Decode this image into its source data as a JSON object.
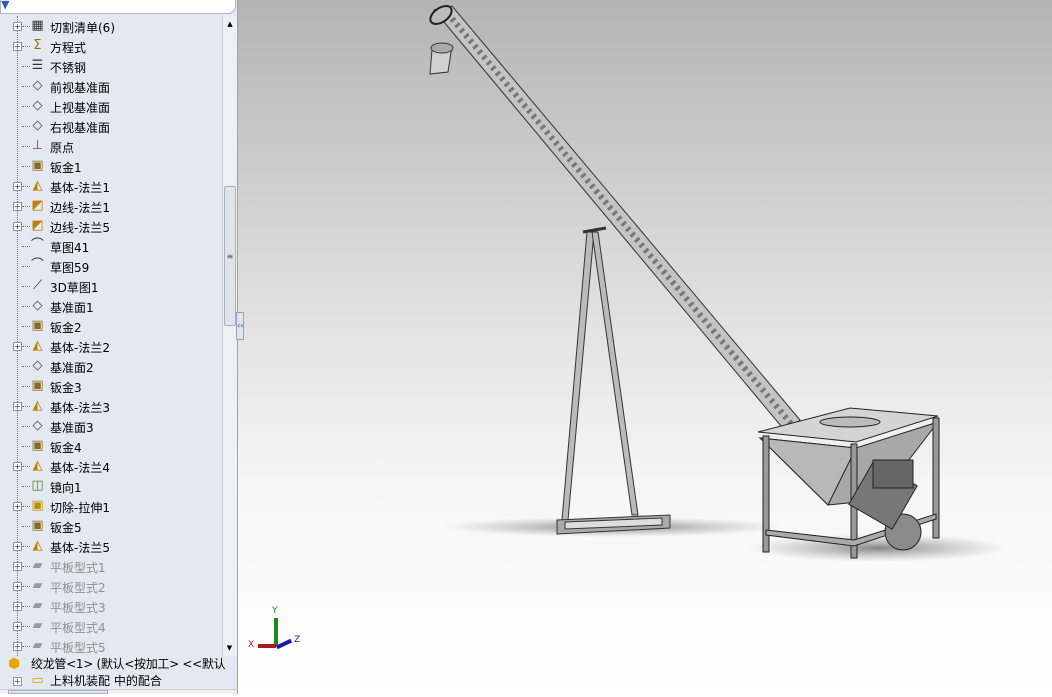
{
  "tree": {
    "items": [
      {
        "label": "切割清单(6)",
        "icon": "cut-list-icon",
        "expand": true
      },
      {
        "label": "方程式",
        "icon": "equations-folder-icon",
        "expand": true
      },
      {
        "label": "不锈钢",
        "icon": "material-icon",
        "expand": false
      },
      {
        "label": "前视基准面",
        "icon": "plane-icon",
        "expand": false
      },
      {
        "label": "上视基准面",
        "icon": "plane-icon",
        "expand": false
      },
      {
        "label": "右视基准面",
        "icon": "plane-icon",
        "expand": false
      },
      {
        "label": "原点",
        "icon": "origin-icon",
        "expand": false
      },
      {
        "label": "钣金1",
        "icon": "sheet-metal-icon",
        "expand": false
      },
      {
        "label": "基体-法兰1",
        "icon": "base-flange-icon",
        "expand": true
      },
      {
        "label": "边线-法兰1",
        "icon": "edge-flange-icon",
        "expand": true
      },
      {
        "label": "边线-法兰5",
        "icon": "edge-flange-icon",
        "expand": true
      },
      {
        "label": "草图41",
        "icon": "sketch-icon",
        "expand": false
      },
      {
        "label": "草图59",
        "icon": "sketch-icon",
        "expand": false
      },
      {
        "label": "3D草图1",
        "icon": "3d-sketch-icon",
        "expand": false
      },
      {
        "label": "基准面1",
        "icon": "plane-icon",
        "expand": false
      },
      {
        "label": "钣金2",
        "icon": "sheet-metal-icon",
        "expand": false
      },
      {
        "label": "基体-法兰2",
        "icon": "base-flange-icon",
        "expand": true
      },
      {
        "label": "基准面2",
        "icon": "plane-icon",
        "expand": false
      },
      {
        "label": "钣金3",
        "icon": "sheet-metal-icon",
        "expand": false
      },
      {
        "label": "基体-法兰3",
        "icon": "base-flange-icon",
        "expand": true
      },
      {
        "label": "基准面3",
        "icon": "plane-icon",
        "expand": false
      },
      {
        "label": "钣金4",
        "icon": "sheet-metal-icon",
        "expand": false
      },
      {
        "label": "基体-法兰4",
        "icon": "base-flange-icon",
        "expand": true
      },
      {
        "label": "镜向1",
        "icon": "mirror-icon",
        "expand": false
      },
      {
        "label": "切除-拉伸1",
        "icon": "cut-extrude-icon",
        "expand": true
      },
      {
        "label": "钣金5",
        "icon": "sheet-metal-icon",
        "expand": false
      },
      {
        "label": "基体-法兰5",
        "icon": "base-flange-icon",
        "expand": true
      },
      {
        "label": "平板型式1",
        "icon": "flat-pattern-icon",
        "expand": true,
        "grey": true
      },
      {
        "label": "平板型式2",
        "icon": "flat-pattern-icon",
        "expand": true,
        "grey": true
      },
      {
        "label": "平板型式3",
        "icon": "flat-pattern-icon",
        "expand": true,
        "grey": true
      },
      {
        "label": "平板型式4",
        "icon": "flat-pattern-icon",
        "expand": true,
        "grey": true
      },
      {
        "label": "平板型式5",
        "icon": "flat-pattern-icon",
        "expand": true,
        "grey": true
      }
    ],
    "component": "绞龙管<1> (默认<按加工> <<默认",
    "mates": "上料机装配 中的配合"
  },
  "triad": {
    "x": "X",
    "y": "Y",
    "z": "Z"
  }
}
